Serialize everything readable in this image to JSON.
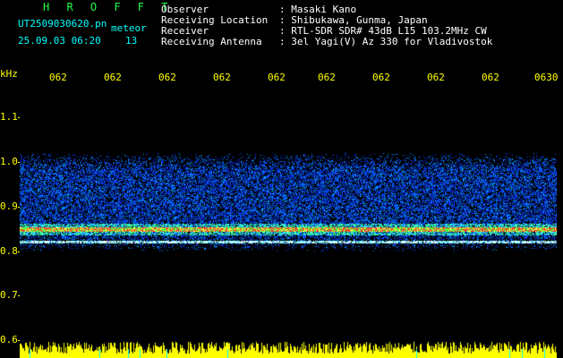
{
  "header": {
    "app_title": "H R O F F T",
    "file_name": "UT2509030620.pn",
    "meteor_label": "meteor",
    "date_time": "25.09.03 06:20",
    "count": "13",
    "fields": [
      {
        "label": "Observer",
        "value": ": Masaki Kano"
      },
      {
        "label": "Receiving Location",
        "value": ": Shibukawa, Gunma, Japan"
      },
      {
        "label": "Receiver",
        "value": ": RTL-SDR SDR# 43dB L15 103.2MHz CW"
      },
      {
        "label": "Receiving Antenna",
        "value": ": 3el Yagi(V) Az 330 for Vladivostok"
      }
    ]
  },
  "xaxis": {
    "ticks": [
      "062",
      "062",
      "062",
      "062",
      "062",
      "062",
      "062",
      "062",
      "062",
      "0630"
    ]
  },
  "yaxis": {
    "unit": "kHz",
    "ticks": [
      "1.1",
      "1.0",
      "0.9",
      "0.8",
      "0.7",
      "0.6"
    ]
  },
  "colors": {
    "title": "#22ff44",
    "text": "#00ffff",
    "axis": "#ffff00"
  }
}
